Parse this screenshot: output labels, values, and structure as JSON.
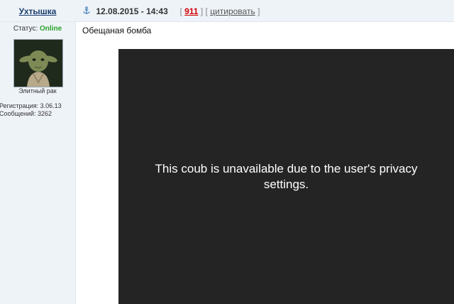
{
  "post": {
    "username": "Ухтышка",
    "date": "12.08.2015 - 14:43",
    "open_bracket": "[",
    "post_number": "911",
    "mid_bracket": "] [",
    "quote_label": "цитировать",
    "close_bracket": "]",
    "anchor_icon": "anchor-icon",
    "title": "Обещаная бомба"
  },
  "user": {
    "status_label": "Статус:",
    "status_value": "Online",
    "status_color": "#2aa12a",
    "rank": "Элитный рак",
    "registration": "Регистрация: 3.06.13",
    "messages": "Сообщений: 3262"
  },
  "video": {
    "message": "This coub is unavailable due to the user's privacy settings.",
    "background": "#242424"
  }
}
